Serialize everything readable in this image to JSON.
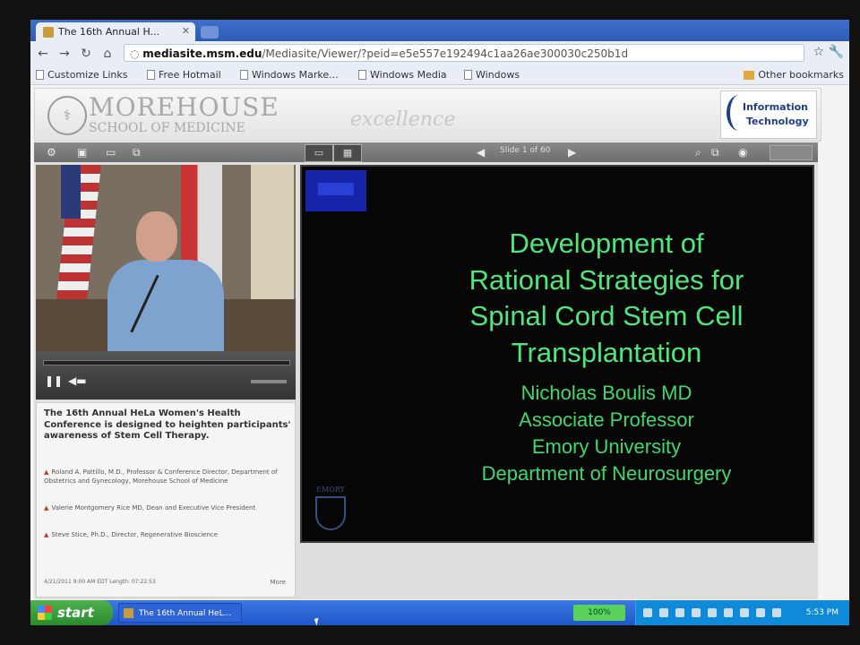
{
  "browser": {
    "tab_title": "The 16th Annual H...",
    "url_host": "mediasite.msm.edu",
    "url_path": "/Mediasite/Viewer/?peid=e5e557e192494c1aa26ae300030c250b1d",
    "bookmarks": [
      {
        "label": "Customize Links"
      },
      {
        "label": "Free Hotmail"
      },
      {
        "label": "Windows Marke..."
      },
      {
        "label": "Windows Media"
      },
      {
        "label": "Windows"
      }
    ],
    "other_bookmarks": "Other bookmarks"
  },
  "banner": {
    "school_name": "MOREHOUSE",
    "school_sub": "SCHOOL OF MEDICINE",
    "tagline": "excellence",
    "it_logo_line1": "Information",
    "it_logo_line2": "Technology"
  },
  "player": {
    "slide_counter": "Slide 1 of 60"
  },
  "presentation": {
    "description": "The 16th Annual HeLa Women's Health Conference is designed to heighten participants' awareness of Stem Cell Therapy.",
    "presenters": [
      "Roland A. Pattillo, M.D., Professor & Conference Director, Department of Obstetrics and Gynecology, Morehouse School of Medicine",
      "Valerie Montgomery Rice MD, Dean and Executive Vice President",
      "Steve Stice, Ph.D., Director, Regenerative Bioscience"
    ],
    "meta": "4/21/2011   9:00 AM EDT   Length: 07:22:53",
    "more_label": "More"
  },
  "slide": {
    "title_lines": [
      "Development of",
      "Rational Strategies for",
      "Spinal Cord Stem Cell",
      "Transplantation"
    ],
    "author_lines": [
      "Nicholas Boulis MD",
      "Associate Professor",
      "Emory University",
      "Department of Neurosurgery"
    ],
    "emory_word": "EMORY"
  },
  "taskbar": {
    "start_label": "start",
    "task_button": "The 16th Annual HeL...",
    "green_badge": "100%",
    "clock": "5:53 PM"
  },
  "colors": {
    "slide_text": "#4fe67a",
    "slide_bg": "#060606",
    "taskbar_blue": "#1f56c8",
    "start_green": "#3a9d3a"
  }
}
